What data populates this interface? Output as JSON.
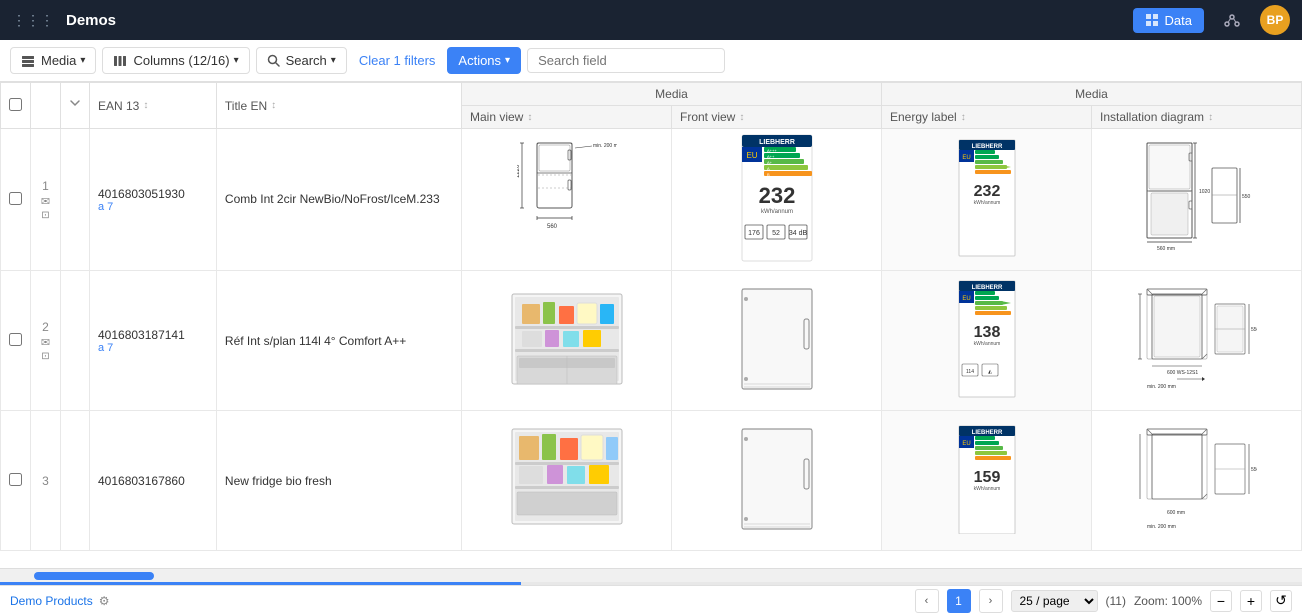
{
  "topbar": {
    "grid_icon": "⋮⋮⋮",
    "title": "Demos",
    "data_label": "Data",
    "graph_label": "○",
    "avatar_initials": "BP"
  },
  "toolbar": {
    "media_label": "Media",
    "columns_label": "Columns (12/16)",
    "search_label": "Search",
    "clear_filters_label": "Clear 1 filters",
    "actions_label": "Actions",
    "search_field_placeholder": "Search field"
  },
  "table": {
    "header_media_1": "Media",
    "header_media_2": "Media",
    "columns": [
      "EAN 13",
      "Title EN",
      "Main view",
      "Front view",
      "Energy label",
      "Installation diagram"
    ],
    "rows": [
      {
        "num": "1",
        "ean": "4016803051930",
        "title": "Comb Int 2cir NewBio/NoFrost/IceM.233",
        "has_indicator": true
      },
      {
        "num": "2",
        "ean": "4016803187141",
        "title": "Réf Int s/plan 114l 4° Comfort A++",
        "has_indicator": true
      },
      {
        "num": "3",
        "ean": "4016803167860",
        "title": "New fridge bio fresh",
        "has_indicator": false
      }
    ]
  },
  "statusbar": {
    "tab_label": "Demo Products",
    "pagination_prev": "‹",
    "pagination_next": "›",
    "current_page": "1",
    "page_size": "25 / page",
    "total": "(11)",
    "zoom_label": "Zoom: 100%",
    "zoom_minus": "−",
    "zoom_plus": "+",
    "zoom_reset": "↺"
  }
}
